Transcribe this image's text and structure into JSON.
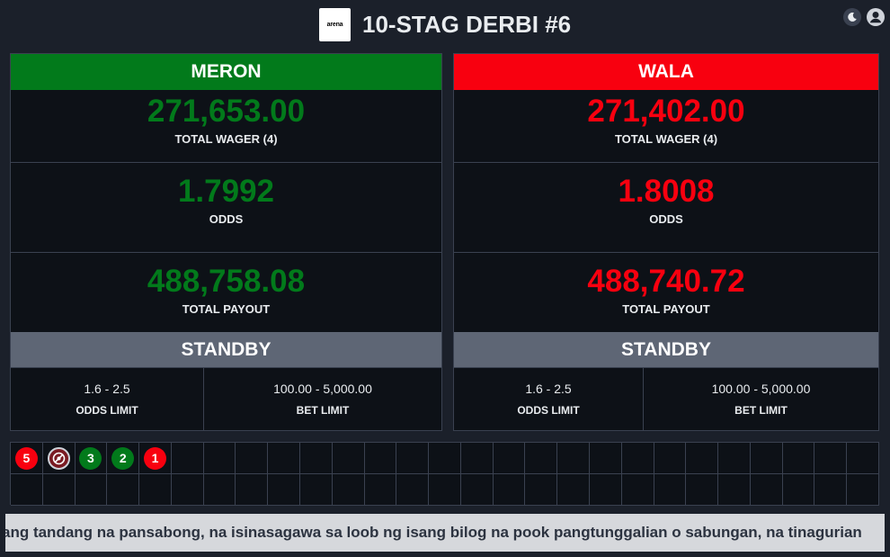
{
  "header": {
    "logo_text": "arena",
    "title": "10-STAG DERBI #6",
    "theme_icon": "moon-icon",
    "user_icon": "user-icon"
  },
  "meron": {
    "label": "MERON",
    "total_wager": "271,653.00",
    "total_wager_label": "TOTAL WAGER (4)",
    "odds": "1.7992",
    "odds_label": "ODDS",
    "total_payout": "488,758.08",
    "total_payout_label": "TOTAL PAYOUT",
    "status": "STANDBY",
    "odds_limit": "1.6 - 2.5",
    "odds_limit_label": "ODDS LIMIT",
    "bet_limit": "100.00 - 5,000.00",
    "bet_limit_label": "BET LIMIT"
  },
  "wala": {
    "label": "WALA",
    "total_wager": "271,402.00",
    "total_wager_label": "TOTAL WAGER (4)",
    "odds": "1.8008",
    "odds_label": "ODDS",
    "total_payout": "488,740.72",
    "total_payout_label": "TOTAL PAYOUT",
    "status": "STANDBY",
    "odds_limit": "1.6 - 2.5",
    "odds_limit_label": "ODDS LIMIT",
    "bet_limit": "100.00 - 5,000.00",
    "bet_limit_label": "BET LIMIT"
  },
  "colors": {
    "meron": "#027a1b",
    "wala": "#f8000f",
    "standby": "#5e6675",
    "background": "#1b202a"
  },
  "results": [
    {
      "number": "5",
      "result": "wala"
    },
    {
      "number": "",
      "result": "draw",
      "icon": "draw-icon"
    },
    {
      "number": "3",
      "result": "meron"
    },
    {
      "number": "2",
      "result": "meron"
    },
    {
      "number": "1",
      "result": "wala"
    }
  ],
  "ticker": {
    "text": "ang tandang na pansabong, na isinasagawa sa loob ng isang bilog na pook pangtunggalian o sabungan, na tinagurian"
  }
}
